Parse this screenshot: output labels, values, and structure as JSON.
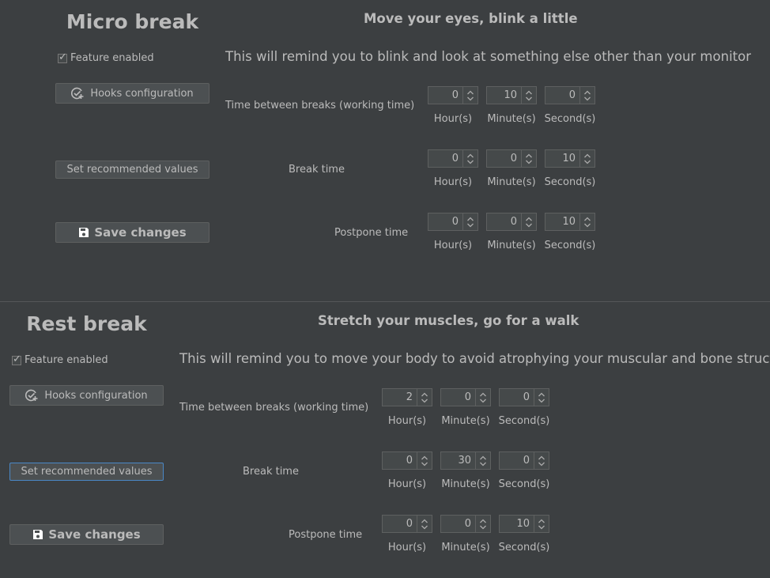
{
  "units": {
    "hours": "Hour(s)",
    "minutes": "Minute(s)",
    "seconds": "Second(s)"
  },
  "micro": {
    "title": "Micro break",
    "subtitle": "Move your eyes, blink a little",
    "feature_enabled_label": "Feature enabled",
    "feature_enabled": true,
    "description": "This will remind you to blink and look at something else other than your monitor",
    "hooks_button": "Hooks configuration",
    "recommended_button": "Set recommended values",
    "save_button": "Save changes",
    "time_between_label": "Time between breaks (working time)",
    "break_time_label": "Break time",
    "postpone_label": "Postpone time",
    "time_between": {
      "hours": "0",
      "minutes": "10",
      "seconds": "0"
    },
    "break_time": {
      "hours": "0",
      "minutes": "0",
      "seconds": "10"
    },
    "postpone": {
      "hours": "0",
      "minutes": "0",
      "seconds": "10"
    }
  },
  "rest": {
    "title": "Rest break",
    "subtitle": "Stretch your muscles, go for a walk",
    "feature_enabled_label": "Feature enabled",
    "feature_enabled": true,
    "description": "This will remind you to move your body to avoid atrophying your muscular and bone structure",
    "hooks_button": "Hooks configuration",
    "recommended_button": "Set recommended values",
    "save_button": "Save changes",
    "time_between_label": "Time between breaks (working time)",
    "break_time_label": "Break time",
    "postpone_label": "Postpone time",
    "time_between": {
      "hours": "2",
      "minutes": "0",
      "seconds": "0"
    },
    "break_time": {
      "hours": "0",
      "minutes": "30",
      "seconds": "0"
    },
    "postpone": {
      "hours": "0",
      "minutes": "0",
      "seconds": "10"
    }
  },
  "icons": {
    "hooks": "check-clock-icon",
    "save": "floppy-disk-icon",
    "spinner": "up-down-arrows-icon"
  }
}
